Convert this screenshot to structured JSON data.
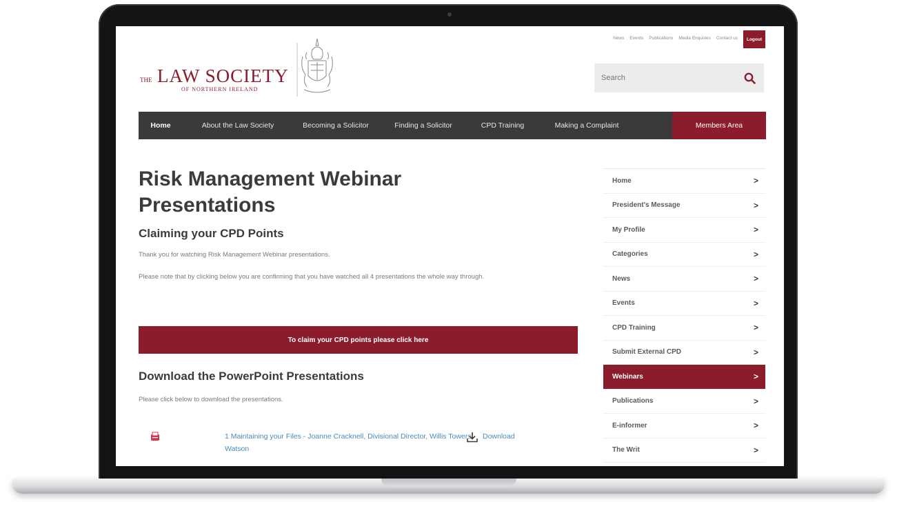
{
  "utility_links": [
    "News",
    "Events",
    "Publications",
    "Media Enquiries",
    "Contact us"
  ],
  "logout_label": "Logout",
  "logo": {
    "the": "THE",
    "main": "LAW SOCIETY",
    "sub": "OF NORTHERN IRELAND"
  },
  "search": {
    "placeholder": "Search",
    "icon": "search-icon"
  },
  "nav": [
    {
      "label": "Home",
      "active": true
    },
    {
      "label": "About the Law Society"
    },
    {
      "label": "Becoming a Solicitor"
    },
    {
      "label": "Finding a Solicitor"
    },
    {
      "label": "CPD Training"
    },
    {
      "label": "Making a Complaint"
    },
    {
      "label": "Members Area"
    }
  ],
  "page": {
    "title": "Risk Management Webinar Presentations",
    "claim_heading": "Claiming your CPD Points",
    "thanks": "Thank you for watching Risk Management Webinar presentations.",
    "note": "Please note that by clicking below you are confirming that you have watched all 4 presentations the whole way through.",
    "claim_button": "To claim your CPD points please click here",
    "download_heading": "Download the PowerPoint Presentations",
    "download_intro": "Please click below to download the presentations.",
    "files": [
      {
        "name": "1 Maintaining your Files - Joanne Cracknell, Divisional Director, Willis Towers Watson",
        "action": "Download",
        "icon": "download-icon",
        "file_icon": "pdf-icon"
      }
    ]
  },
  "sidebar": [
    {
      "label": "Home"
    },
    {
      "label": "President's Message"
    },
    {
      "label": "My Profile"
    },
    {
      "label": "Categories"
    },
    {
      "label": "News"
    },
    {
      "label": "Events"
    },
    {
      "label": "CPD Training"
    },
    {
      "label": "Submit External CPD"
    },
    {
      "label": "Webinars",
      "active": true
    },
    {
      "label": "Publications"
    },
    {
      "label": "E-informer"
    },
    {
      "label": "The Writ"
    }
  ],
  "sidebar_chevron": ">",
  "colors": {
    "brand": "#8a1c2b",
    "nav_bg": "#3a3a3a",
    "link": "#4a8ab8"
  }
}
